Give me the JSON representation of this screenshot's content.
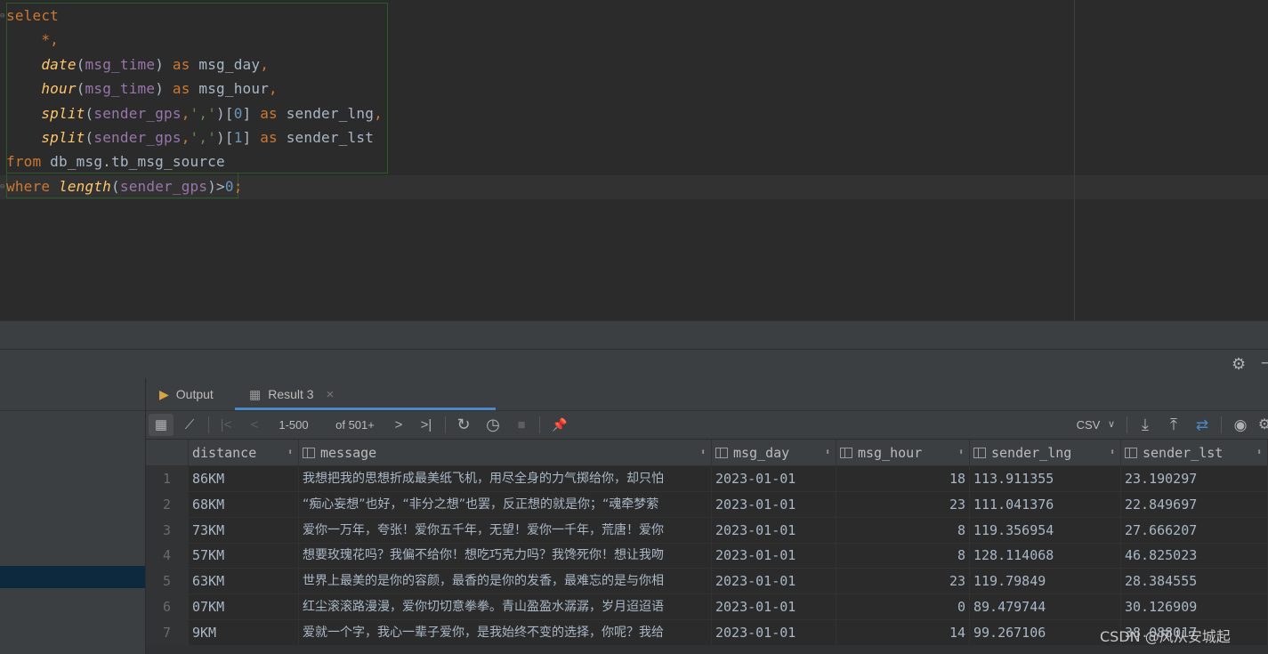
{
  "editor": {
    "lines": [
      [
        {
          "c": "kw",
          "t": "select"
        }
      ],
      [
        {
          "c": "plain",
          "t": "    "
        },
        {
          "c": "kw",
          "t": "*,"
        }
      ],
      [
        {
          "c": "plain",
          "t": "    "
        },
        {
          "c": "fn",
          "t": "date"
        },
        {
          "c": "plain",
          "t": "("
        },
        {
          "c": "id",
          "t": "msg_time"
        },
        {
          "c": "plain",
          "t": ") "
        },
        {
          "c": "kw",
          "t": "as"
        },
        {
          "c": "plain",
          "t": " msg_day"
        },
        {
          "c": "kw",
          "t": ","
        }
      ],
      [
        {
          "c": "plain",
          "t": "    "
        },
        {
          "c": "fn",
          "t": "hour"
        },
        {
          "c": "plain",
          "t": "("
        },
        {
          "c": "id",
          "t": "msg_time"
        },
        {
          "c": "plain",
          "t": ") "
        },
        {
          "c": "kw",
          "t": "as"
        },
        {
          "c": "plain",
          "t": " msg_hour"
        },
        {
          "c": "kw",
          "t": ","
        }
      ],
      [
        {
          "c": "plain",
          "t": "    "
        },
        {
          "c": "fn",
          "t": "split"
        },
        {
          "c": "plain",
          "t": "("
        },
        {
          "c": "id",
          "t": "sender_gps"
        },
        {
          "c": "kw",
          "t": ","
        },
        {
          "c": "str",
          "t": "','"
        },
        {
          "c": "plain",
          "t": ")["
        },
        {
          "c": "num",
          "t": "0"
        },
        {
          "c": "plain",
          "t": "] "
        },
        {
          "c": "kw",
          "t": "as"
        },
        {
          "c": "plain",
          "t": " sender_lng"
        },
        {
          "c": "kw",
          "t": ","
        }
      ],
      [
        {
          "c": "plain",
          "t": "    "
        },
        {
          "c": "fn",
          "t": "split"
        },
        {
          "c": "plain",
          "t": "("
        },
        {
          "c": "id",
          "t": "sender_gps"
        },
        {
          "c": "kw",
          "t": ","
        },
        {
          "c": "str",
          "t": "','"
        },
        {
          "c": "plain",
          "t": ")["
        },
        {
          "c": "num",
          "t": "1"
        },
        {
          "c": "plain",
          "t": "] "
        },
        {
          "c": "kw",
          "t": "as"
        },
        {
          "c": "plain",
          "t": " sender_lst"
        }
      ],
      [
        {
          "c": "kw",
          "t": "from"
        },
        {
          "c": "plain",
          "t": " db_msg.tb_msg_source"
        }
      ],
      [
        {
          "c": "kw",
          "t": "where"
        },
        {
          "c": "plain",
          "t": " "
        },
        {
          "c": "fn",
          "t": "length"
        },
        {
          "c": "plain",
          "t": "("
        },
        {
          "c": "id",
          "t": "sender_gps"
        },
        {
          "c": "plain",
          "t": ")>"
        },
        {
          "c": "num",
          "t": "0"
        },
        {
          "c": "kw",
          "t": ";"
        }
      ]
    ]
  },
  "tabs": {
    "output": "Output",
    "result": "Result 3",
    "close": "×"
  },
  "toolbar": {
    "range": "1-500",
    "of": "of 501+",
    "format": "CSV",
    "icons": {
      "table_view": "▦",
      "chart_view": "⟋",
      "first": "|<",
      "prev": "<",
      "next": ">",
      "last": ">|",
      "refresh": "↻",
      "history": "◷",
      "stop": "■",
      "pin": "📌",
      "download": "⤓",
      "upload": "⤒",
      "compare": "⇄",
      "view": "◉",
      "format_chevron": "∨",
      "settings": "⚙"
    }
  },
  "panel_header": {
    "settings": "⚙",
    "minimize": "–"
  },
  "grid": {
    "columns": [
      "distance",
      "message",
      "msg_day",
      "msg_hour",
      "sender_lng",
      "sender_lst"
    ],
    "sort_icon": "⬍",
    "rows": [
      {
        "n": "1",
        "distance": "86KM",
        "message": "我想把我的思想折成最美纸飞机，用尽全身的力气掷给你，却只怕",
        "msg_day": "2023-01-01",
        "msg_hour": "18",
        "sender_lng": "113.911355",
        "sender_lst": "23.190297"
      },
      {
        "n": "2",
        "distance": "68KM",
        "message": "“痴心妄想”也好，“非分之想”也罢，反正想的就是你；“魂牵梦萦",
        "msg_day": "2023-01-01",
        "msg_hour": "23",
        "sender_lng": "111.041376",
        "sender_lst": "22.849697"
      },
      {
        "n": "3",
        "distance": "73KM",
        "message": "爱你一万年，夸张！爱你五千年，无望！爱你一千年，荒唐！爱你",
        "msg_day": "2023-01-01",
        "msg_hour": "8",
        "sender_lng": "119.356954",
        "sender_lst": "27.666207"
      },
      {
        "n": "4",
        "distance": "57KM",
        "message": "想要玫瑰花吗？我偏不给你！想吃巧克力吗？我馋死你！想让我吻",
        "msg_day": "2023-01-01",
        "msg_hour": "8",
        "sender_lng": "128.114068",
        "sender_lst": "46.825023"
      },
      {
        "n": "5",
        "distance": "63KM",
        "message": "世界上最美的是你的容颜，最香的是你的发香，最难忘的是与你相",
        "msg_day": "2023-01-01",
        "msg_hour": "23",
        "sender_lng": "119.79849",
        "sender_lst": "28.384555"
      },
      {
        "n": "6",
        "distance": "07KM",
        "message": "红尘滚滚路漫漫，爱你切切意拳拳。青山盈盈水潺潺，岁月迢迢语",
        "msg_day": "2023-01-01",
        "msg_hour": "0",
        "sender_lng": "89.479744",
        "sender_lst": "30.126909"
      },
      {
        "n": "7",
        "distance": "9KM",
        "message": "爱就一个字，我心一辈子爱你，是我始终不变的选择，你呢？我给",
        "msg_day": "2023-01-01",
        "msg_hour": "14",
        "sender_lng": "99.267106",
        "sender_lst": "38.088017"
      }
    ]
  },
  "watermark": "CSDN @风从安城起"
}
